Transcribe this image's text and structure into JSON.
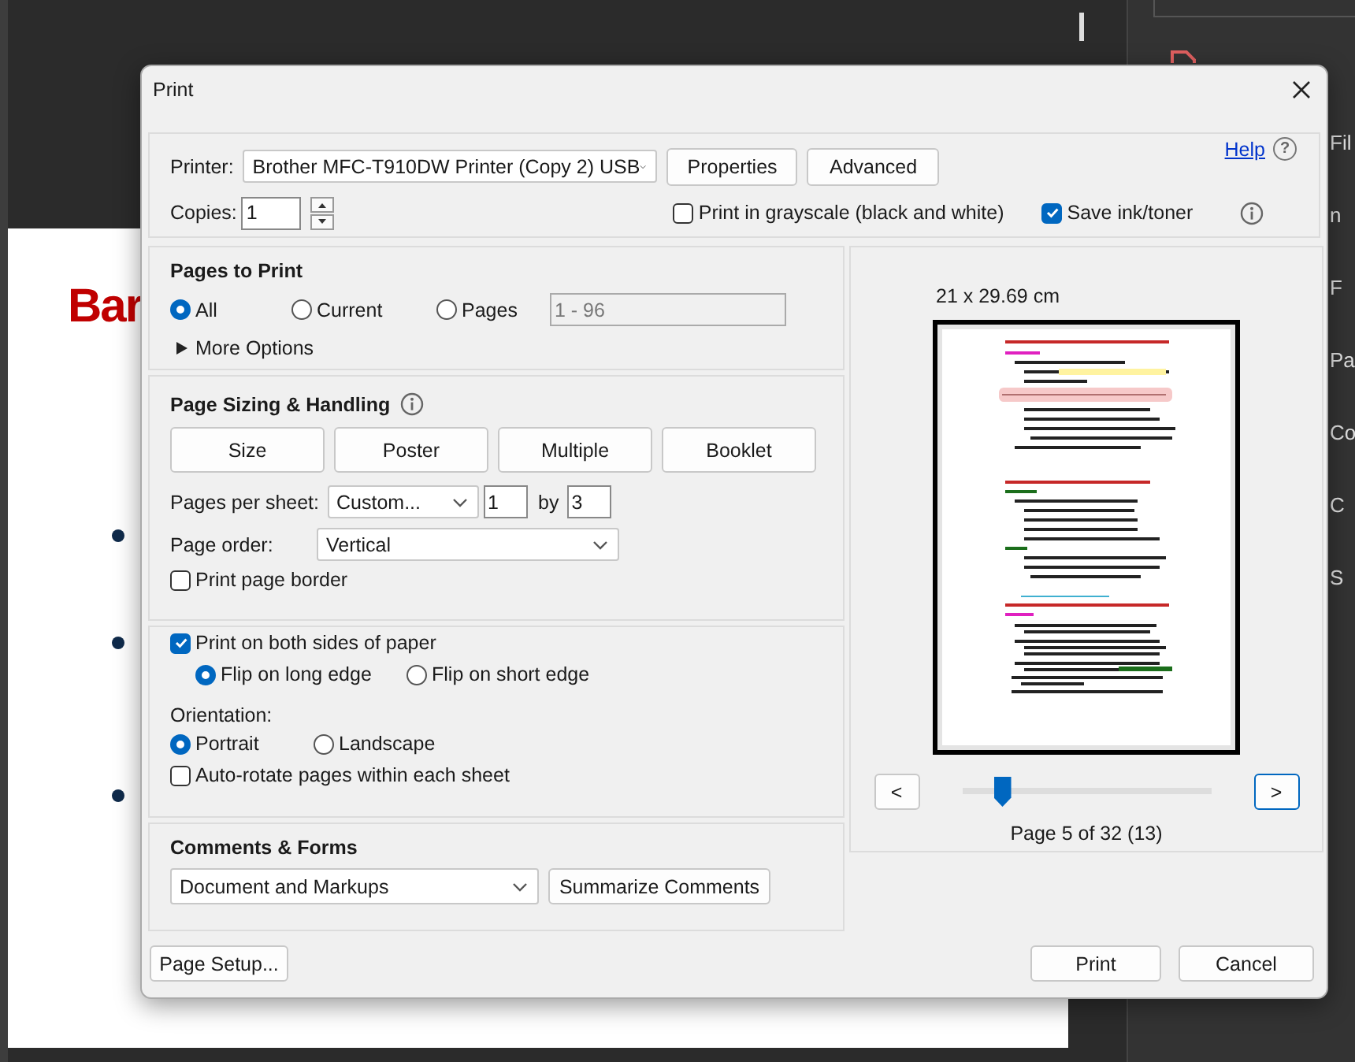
{
  "background": {
    "heading": "Bar",
    "sidebar_fragments": [
      "Fil",
      "n",
      "F",
      "Pa",
      "Co",
      "C",
      "S"
    ]
  },
  "dialog": {
    "title": "Print"
  },
  "printer": {
    "label": "Printer:",
    "value": "Brother MFC-T910DW Printer (Copy 2) USB",
    "buttons": [
      "Properties",
      "Advanced"
    ]
  },
  "help": {
    "label": "Help",
    "glyph": "?"
  },
  "copies": {
    "label": "Copies:",
    "value": "1"
  },
  "grayscale": {
    "label": "Print in grayscale (black and white)",
    "checked": false
  },
  "save_ink": {
    "label": "Save ink/toner",
    "checked": true
  },
  "pages_to_print": {
    "title": "Pages to Print",
    "options": [
      {
        "label": "All",
        "selected": true
      },
      {
        "label": "Current",
        "selected": false
      },
      {
        "label": "Pages",
        "selected": false
      }
    ],
    "range": {
      "value": "1 - 96",
      "disabled": true
    },
    "more_options": {
      "label": "More Options",
      "expanded": false
    }
  },
  "page_sizing": {
    "title": "Page Sizing & Handling",
    "modes": [
      "Size",
      "Poster",
      "Multiple",
      "Booklet"
    ],
    "pages_per_sheet": {
      "label": "Pages per sheet:",
      "value": "Custom...",
      "columns": "1",
      "by": "by",
      "rows": "3"
    },
    "page_order": {
      "label": "Page order:",
      "value": "Vertical"
    },
    "print_border": {
      "label": "Print page border",
      "checked": false
    }
  },
  "duplex": {
    "label": "Print on both sides of paper",
    "checked": true,
    "options": [
      {
        "label": "Flip on long edge",
        "selected": true
      },
      {
        "label": "Flip on short edge",
        "selected": false
      }
    ]
  },
  "orientation": {
    "label": "Orientation:",
    "options": [
      {
        "label": "Portrait",
        "selected": true
      },
      {
        "label": "Landscape",
        "selected": false
      }
    ]
  },
  "auto_rotate": {
    "label": "Auto-rotate pages within each sheet",
    "checked": false
  },
  "comments": {
    "title": "Comments & Forms",
    "value": "Document and Markups",
    "button": "Summarize Comments"
  },
  "preview": {
    "size": "21 x 29.69 cm",
    "prev": "<",
    "next": ">",
    "slider": {
      "level": 0.16
    },
    "page_label": "Page 5 of 32 (13)"
  },
  "footer": {
    "page_setup": "Page Setup...",
    "print": "Print",
    "cancel": "Cancel"
  }
}
